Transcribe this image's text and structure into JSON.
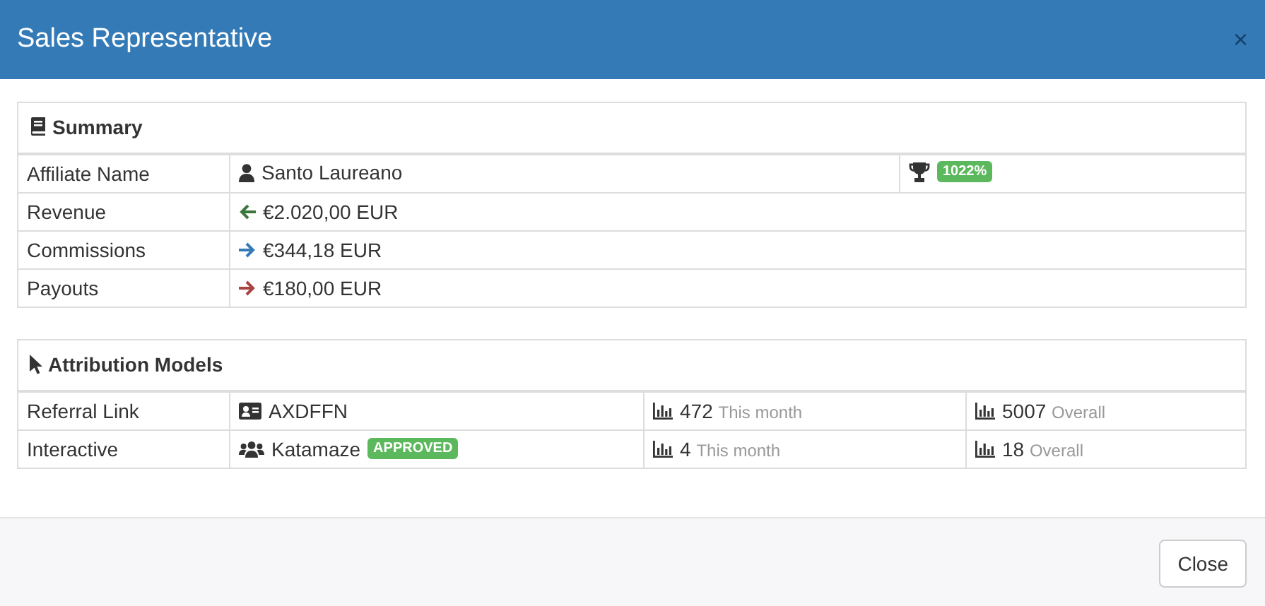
{
  "modal": {
    "title": "Sales Representative",
    "close": "×"
  },
  "summary": {
    "title": "Summary",
    "rows": [
      {
        "kind": "person",
        "label": "Affiliate Name",
        "value": "Santo Laureano",
        "badge": "1022%"
      },
      {
        "kind": "arrow_left",
        "label": "Revenue",
        "value": "€2.020,00 EUR",
        "color": "#3c763d"
      },
      {
        "kind": "arrow_right",
        "label": "Commissions",
        "value": "€344,18 EUR",
        "color": "#337ab7"
      },
      {
        "kind": "arrow_right",
        "label": "Payouts",
        "value": "€180,00 EUR",
        "color": "#a94442"
      }
    ]
  },
  "attribution": {
    "title": "Attribution Models",
    "rows": [
      {
        "kind": "card",
        "label": "Referral Link",
        "value": "AXDFFN",
        "month_count": "472",
        "month_label": "This month",
        "overall_count": "5007",
        "overall_label": "Overall"
      },
      {
        "kind": "group",
        "label": "Interactive",
        "value": "Katamaze",
        "status": "APPROVED",
        "month_count": "4",
        "month_label": "This month",
        "overall_count": "18",
        "overall_label": "Overall"
      }
    ]
  },
  "footer": {
    "buttons": [
      "Close"
    ]
  }
}
